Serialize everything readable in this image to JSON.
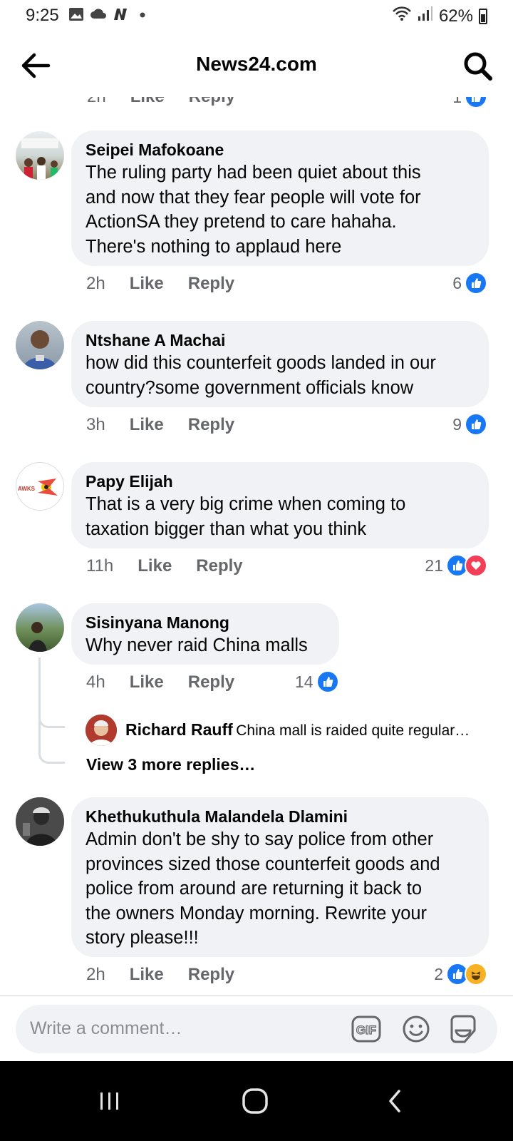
{
  "status_bar": {
    "time": "9:25",
    "battery": "62%"
  },
  "header": {
    "title": "News24.com"
  },
  "partial_top": {
    "time": "2h",
    "like": "Like",
    "reply": "Reply",
    "reactions": "1"
  },
  "comments": [
    {
      "author": "Seipei Mafokoane",
      "lines": [
        "The ruling party had been quiet about this",
        "and now that they fear people will vote for",
        "ActionSA they pretend to care hahaha.",
        "There's nothing to applaud here"
      ],
      "time": "2h",
      "like": "Like",
      "reply": "Reply",
      "reactions": "6"
    },
    {
      "author": "Ntshane A Machai",
      "lines": [
        "how did this counterfeit goods landed in our",
        "country?some government officials know"
      ],
      "time": "3h",
      "like": "Like",
      "reply": "Reply",
      "reactions": "9"
    },
    {
      "author": "Papy Elijah",
      "lines": [
        "That is a very big crime when coming to",
        "taxation bigger than what you think"
      ],
      "time": "11h",
      "like": "Like",
      "reply": "Reply",
      "reactions": "21"
    },
    {
      "author": "Sisinyana Manong",
      "lines": [
        "Why never raid China malls"
      ],
      "time": "4h",
      "like": "Like",
      "reply": "Reply",
      "reactions": "14",
      "reply_preview": {
        "author": "Richard Rauff",
        "text": "China mall is raided quite regular…"
      },
      "more_replies": "View 3 more replies…"
    },
    {
      "author": "Khethukuthula Malandela Dlamini",
      "lines": [
        "Admin don't be shy to say police from other",
        "provinces sized those counterfeit goods and",
        "police from around are returning it back to",
        "the owners Monday morning. Rewrite your",
        "story please!!!"
      ],
      "time": "2h",
      "like": "Like",
      "reply": "Reply",
      "reactions": "2"
    }
  ],
  "composer": {
    "placeholder": "Write a comment…"
  },
  "icons": {
    "back": "back-arrow-icon",
    "search": "search-icon",
    "like_reaction": "like-reaction-icon",
    "love_reaction": "love-reaction-icon",
    "haha_reaction": "haha-reaction-icon",
    "gif": "gif-icon",
    "emoji": "emoji-icon",
    "sticker": "sticker-icon"
  },
  "colors": {
    "like_blue": "#1877f2",
    "love_red": "#f33e58",
    "bubble_bg": "#f0f2f5",
    "meta_gray": "#65676b"
  }
}
